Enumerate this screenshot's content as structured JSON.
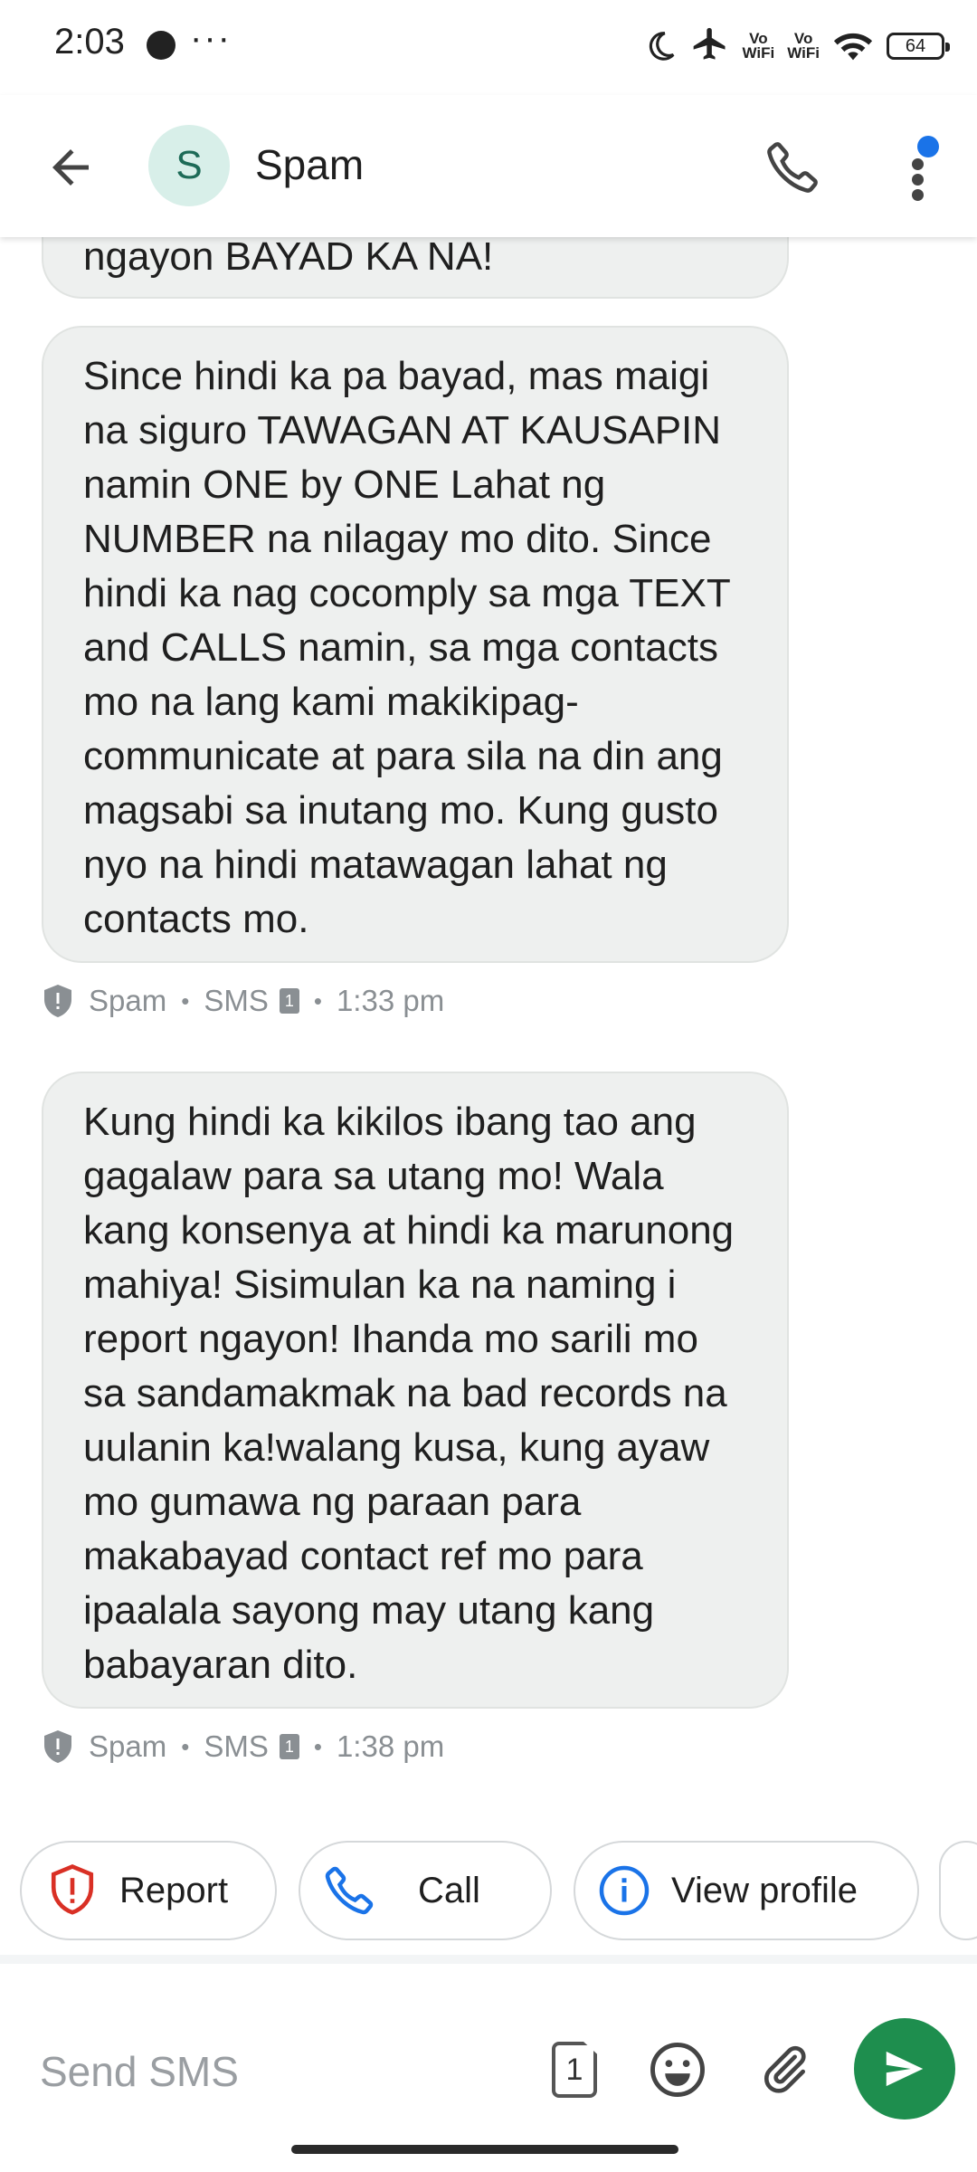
{
  "status_bar": {
    "time": "2:03",
    "more": "···",
    "vo_wifi": [
      "Vo",
      "WiFi"
    ],
    "vo_wifi2": [
      "Vo",
      "WiFi"
    ],
    "battery": "64"
  },
  "header": {
    "avatar_letter": "S",
    "title": "Spam"
  },
  "messages": [
    {
      "text": "ngayon BAYAD KA NA!"
    },
    {
      "text": "Since hindi ka pa bayad, mas maigi na siguro TAWAGAN AT KAUSAPIN namin ONE by ONE Lahat ng NUMBER na nilagay mo dito. Since hindi ka nag cocomply sa mga TEXT and CALLS namin, sa mga contacts mo na lang kami makikipag-communicate at para sila na din ang magsabi sa inutang mo. Kung gusto nyo na hindi matawagan lahat ng contacts mo.",
      "label": "Spam",
      "channel": "SMS",
      "sim": "1",
      "time": "1:33 pm"
    },
    {
      "text": "Kung hindi ka kikilos ibang tao ang gagalaw para sa utang mo! Wala kang konsenya at hindi ka marunong mahiya! Sisimulan ka na naming i report ngayon! Ihanda mo sarili mo sa sandamakmak na bad records na uulanin ka!walang kusa, kung ayaw mo gumawa ng paraan para makabayad contact ref mo para ipaalala sayong may utang kang babayaran dito.",
      "label": "Spam",
      "channel": "SMS",
      "sim": "1",
      "time": "1:38 pm"
    }
  ],
  "actions": {
    "report": "Report",
    "call": "Call",
    "view_profile": "View profile"
  },
  "composer": {
    "placeholder": "Send SMS",
    "sim": "1"
  },
  "colors": {
    "accent_blue": "#1a73e8",
    "send_green": "#1e8e4e",
    "report_red": "#d93025",
    "bubble_bg": "#eef0ef"
  }
}
